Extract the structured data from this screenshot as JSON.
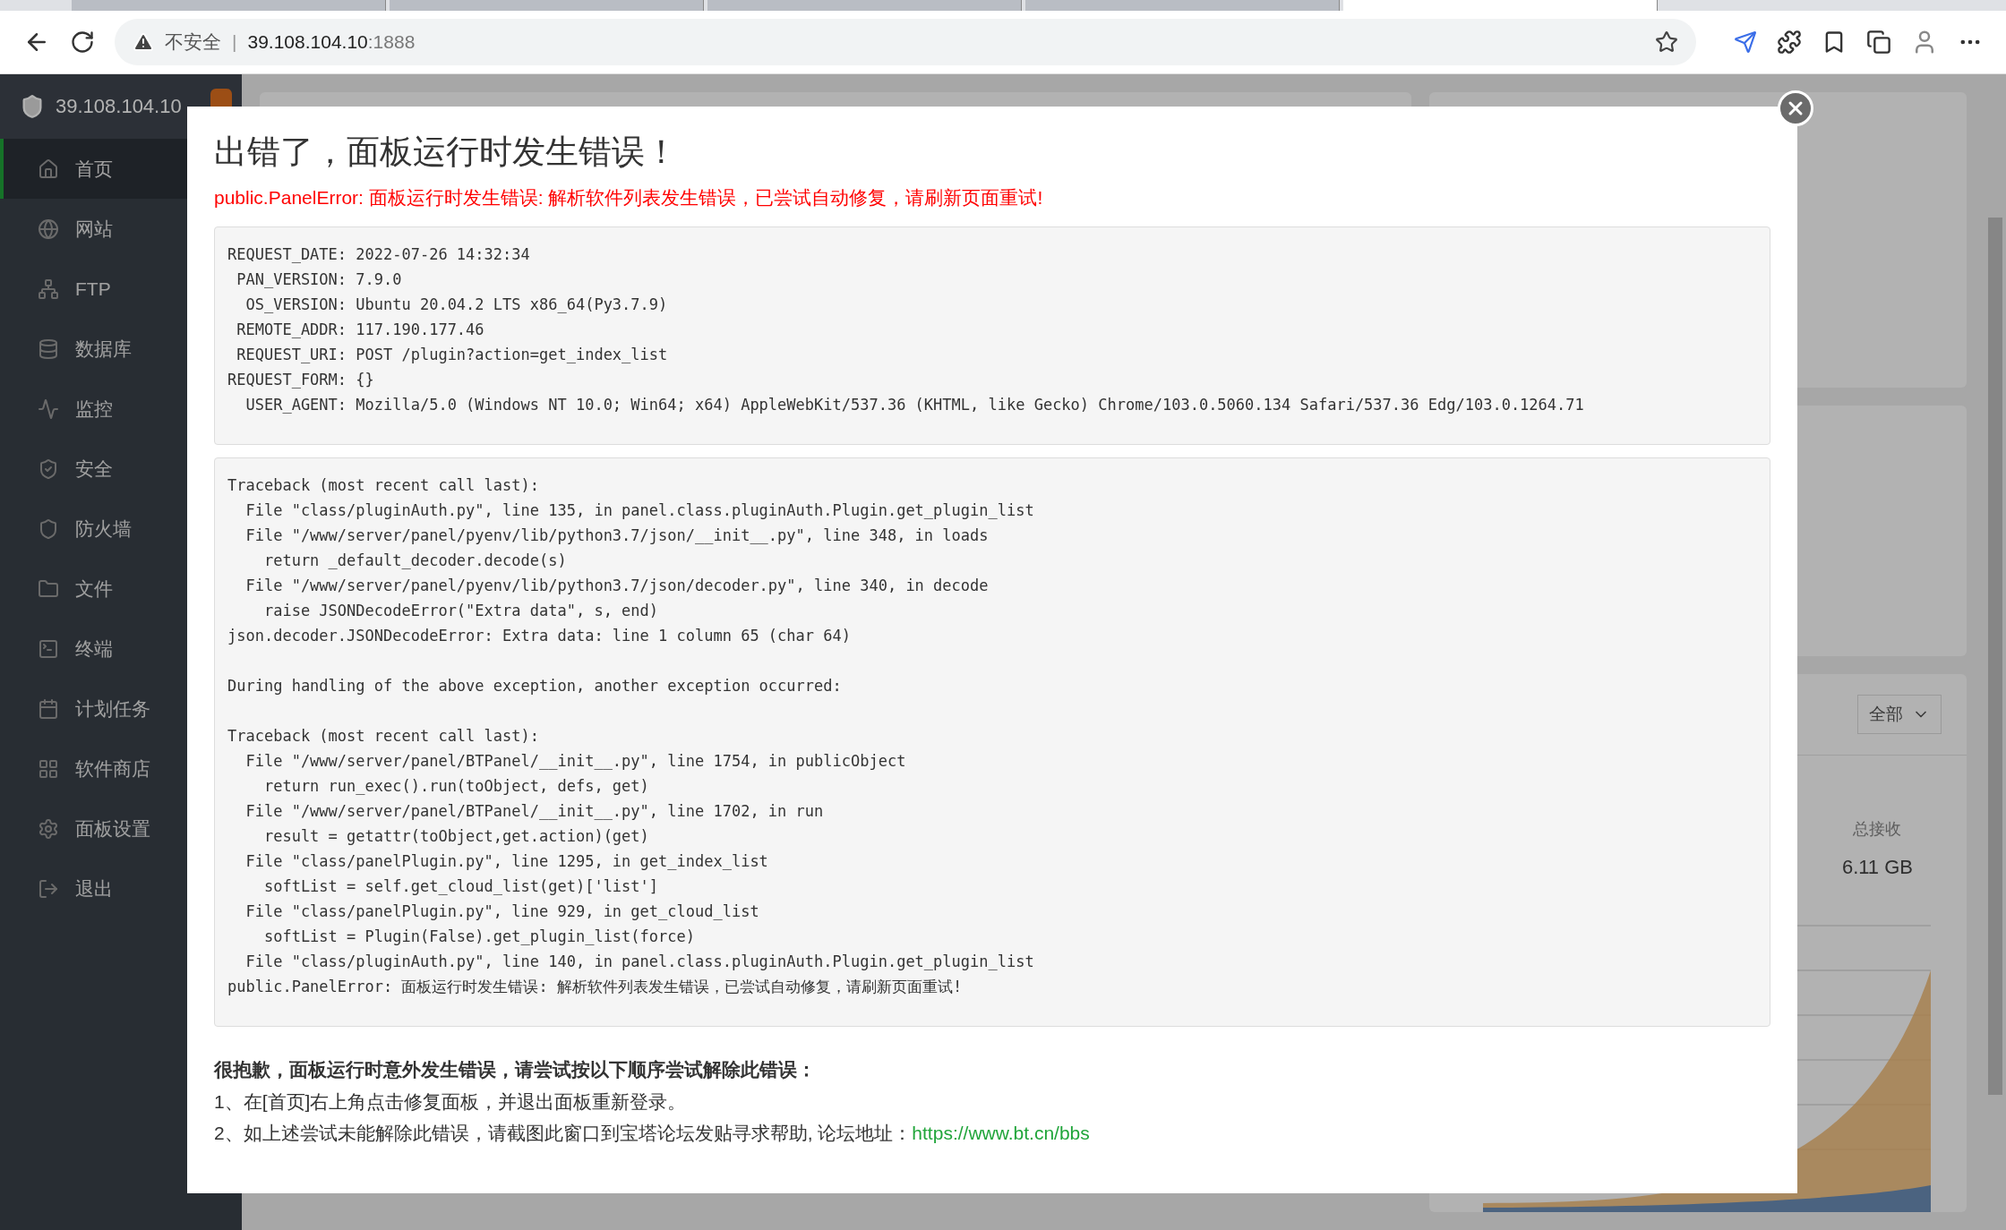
{
  "browser": {
    "tabs": [
      {
        "selected": false
      },
      {
        "selected": false
      },
      {
        "selected": false
      },
      {
        "selected": false
      },
      {
        "selected": true
      }
    ],
    "address": {
      "security_label": "不安全",
      "separator": "|",
      "host": "39.108.104.10",
      "port": ":1888"
    }
  },
  "sidebar": {
    "host": "39.108.104.10",
    "items": [
      {
        "label": "首页",
        "selected": true
      },
      {
        "label": "网站",
        "selected": false
      },
      {
        "label": "FTP",
        "selected": false
      },
      {
        "label": "数据库",
        "selected": false
      },
      {
        "label": "监控",
        "selected": false
      },
      {
        "label": "安全",
        "selected": false
      },
      {
        "label": "防火墙",
        "selected": false
      },
      {
        "label": "文件",
        "selected": false
      },
      {
        "label": "终端",
        "selected": false
      },
      {
        "label": "计划任务",
        "selected": false
      },
      {
        "label": "软件商店",
        "selected": false
      },
      {
        "label": "面板设置",
        "selected": false
      },
      {
        "label": "退出",
        "selected": false
      }
    ]
  },
  "background": {
    "filter": "全部",
    "stat_label": "总接收",
    "stat_value": "6.11 GB"
  },
  "dialog": {
    "title": "出错了，面板运行时发生错误！",
    "error_message": "public.PanelError: 面板运行时发生错误: 解析软件列表发生错误，已尝试自动修复，请刷新页面重试!",
    "request_info": [
      "REQUEST_DATE: 2022-07-26 14:32:34",
      " PAN_VERSION: 7.9.0",
      "  OS_VERSION: Ubuntu 20.04.2 LTS x86_64(Py3.7.9)",
      " REMOTE_ADDR: 117.190.177.46",
      " REQUEST_URI: POST /plugin?action=get_index_list",
      "REQUEST_FORM: {}",
      "  USER_AGENT: Mozilla/5.0 (Windows NT 10.0; Win64; x64) AppleWebKit/537.36 (KHTML, like Gecko) Chrome/103.0.5060.134 Safari/537.36 Edg/103.0.1264.71"
    ],
    "traceback": [
      [
        "Traceback (most recent call last):",
        "  File \"class/pluginAuth.py\", line 135, in panel.class.pluginAuth.Plugin.get_plugin_list",
        "  File \"/www/server/panel/pyenv/lib/python3.7/json/__init__.py\", line 348, in loads",
        "    return _default_decoder.decode(s)",
        "  File \"/www/server/panel/pyenv/lib/python3.7/json/decoder.py\", line 340, in decode",
        "    raise JSONDecodeError(\"Extra data\", s, end)",
        "json.decoder.JSONDecodeError: Extra data: line 1 column 65 (char 64)"
      ],
      [
        "During handling of the above exception, another exception occurred:"
      ],
      [
        "Traceback (most recent call last):",
        "  File \"/www/server/panel/BTPanel/__init__.py\", line 1754, in publicObject",
        "    return run_exec().run(toObject, defs, get)",
        "  File \"/www/server/panel/BTPanel/__init__.py\", line 1702, in run",
        "    result = getattr(toObject,get.action)(get)",
        "  File \"class/panelPlugin.py\", line 1295, in get_index_list",
        "    softList = self.get_cloud_list(get)['list']",
        "  File \"class/panelPlugin.py\", line 929, in get_cloud_list",
        "    softList = Plugin(False).get_plugin_list(force)",
        "  File \"class/pluginAuth.py\", line 140, in panel.class.pluginAuth.Plugin.get_plugin_list",
        "public.PanelError: 面板运行时发生错误: 解析软件列表发生错误，已尝试自动修复，请刷新页面重试!"
      ]
    ],
    "help_heading": "很抱歉，面板运行时意外发生错误，请尝试按以下顺序尝试解除此错误：",
    "help_steps": [
      "1、在[首页]右上角点击修复面板，并退出面板重新登录。",
      "2、如上述尝试未能解除此错误，请截图此窗口到宝塔论坛发贴寻求帮助, 论坛地址："
    ],
    "forum_link": "https://www.bt.cn/bbs"
  }
}
